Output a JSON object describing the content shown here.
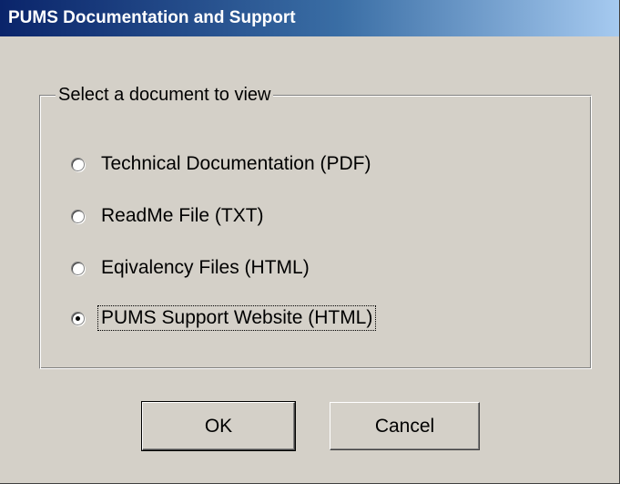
{
  "window": {
    "title": "PUMS Documentation and Support"
  },
  "group": {
    "label": "Select a document to view"
  },
  "options": [
    {
      "label": "Technical Documentation (PDF)",
      "selected": false
    },
    {
      "label": "ReadMe File (TXT)",
      "selected": false
    },
    {
      "label": "Eqivalency Files (HTML)",
      "selected": false
    },
    {
      "label": "PUMS Support Website (HTML)",
      "selected": true
    }
  ],
  "buttons": {
    "ok": "OK",
    "cancel": "Cancel"
  }
}
